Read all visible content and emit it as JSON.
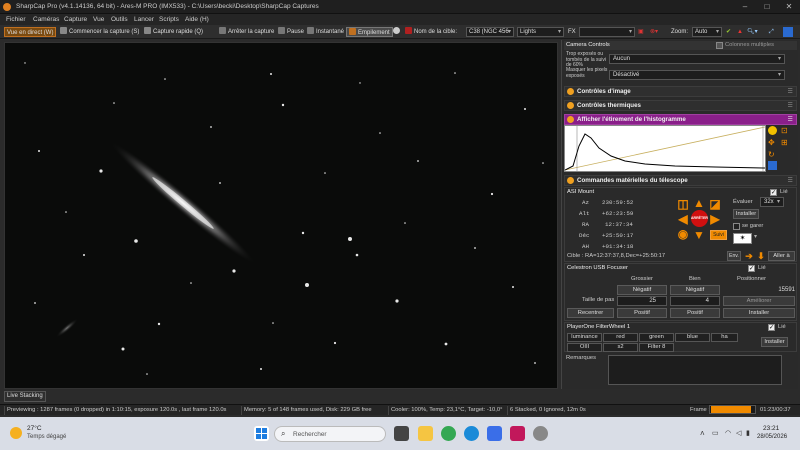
{
  "window": {
    "title": "SharpCap Pro (v4.1.14136, 64 bit) - Ares-M PRO (IMX533) - C:\\Users\\becki\\Desktop\\SharpCap Captures"
  },
  "menu": [
    "Fichier",
    "Caméras",
    "Capture",
    "Vue",
    "Outils",
    "Lancer",
    "Scripts",
    "Aide (H)"
  ],
  "toolbar": {
    "live_view": "Vue en direct (W)",
    "start_capture": "Commencer la capture (S)",
    "quick_capture": "Capture rapide (Q)",
    "stop_capture": "Arrêter la capture",
    "pause": "Pause",
    "snapshot": "Instantané",
    "stacking": "Empilement",
    "target_label": "Nom de la cible:",
    "target_value": "C38 (NGC 456",
    "frame_type": "Lights",
    "fx_label": "FX",
    "zoom_label": "Zoom:",
    "zoom_value": "Auto"
  },
  "panel": {
    "title": "Camera Controls",
    "multi_columns": "Colonnes multiples",
    "exposure_label": "Trop exposés ou tombés de la suivi de 60%",
    "exposure_value": "Aucun",
    "mask_label": "Masquer les pixels exposés",
    "mask_value": "Désactivé",
    "image_controls": "Contrôles d'image",
    "thermal_controls": "Contrôles thermiques",
    "histogram_header": "Afficher l'étirement de l'histogramme",
    "telescope_header": "Commandes matérielles du télescope",
    "mount": {
      "name": "ASI Mount",
      "linked_label": "Lié",
      "az_label": "Az",
      "az": "230:59:52",
      "alt_label": "Alt",
      "alt": "+62:23:59",
      "ra_label": "RA",
      "ra": "12:37:34",
      "dec_label": "Déc",
      "dec": "+25:50:17",
      "ah_label": "AH",
      "ah": "+01:34:18",
      "speed_label": "Évaluer",
      "speed_value": "32x",
      "install": "Installer",
      "park": "se garer",
      "stop": "ARRÊTER",
      "follow": "Suivi",
      "target": "Cible : RA=12:37:37,8,Dec=+25:50:17",
      "send": "Env.",
      "goto": "Aller à"
    },
    "focuser": {
      "name": "Celestron USB Focuser",
      "linked_label": "Lié",
      "coarse": "Grossier",
      "fine": "Bien",
      "position_label": "Positionner",
      "negative1": "Négatif",
      "negative2": "Négatif",
      "position_value": "15591",
      "step_label": "Taille de pas",
      "step_coarse": "25",
      "step_fine": "4",
      "refine": "Améliorer",
      "recenter": "Recentrer",
      "positive1": "Positif",
      "positive2": "Positif",
      "install": "Installer"
    },
    "filterwheel": {
      "name": "PlayerOne FilterWheel 1",
      "linked_label": "Lié",
      "filters_row1": [
        "luminance",
        "red",
        "green",
        "blue",
        "ha"
      ],
      "filters_row2": [
        "OIII",
        "s2",
        "Filter 8"
      ],
      "install": "Installer"
    },
    "remarks_label": "Remarques"
  },
  "live_stacking": "Live Stacking",
  "status": {
    "previewing": "Previewing : 1287 frames (0 dropped) in 1:10:15, exposure 120.0s , last frame 120.0s",
    "memory": "Memory: 5 of 148 frames used, Disk: 229 GB free",
    "cooler": "Cooler: 100%, Temp: 23,1°C, Target: -10,0°",
    "stacked": "6 Stacked, 0 Ignored, 12m 0s",
    "frame_label": "Frame :",
    "frame_progress": 0.88,
    "time": "01:23/00:37"
  },
  "taskbar": {
    "temp": "27°C",
    "weather": "Temps dégagé",
    "search_placeholder": "Rechercher",
    "clock_time": "23:21",
    "clock_date": "28/05/2026"
  },
  "colors": {
    "accent": "#f08a00",
    "histogram_header": "#8a1f8a",
    "taskbar": "#d9dde6"
  }
}
